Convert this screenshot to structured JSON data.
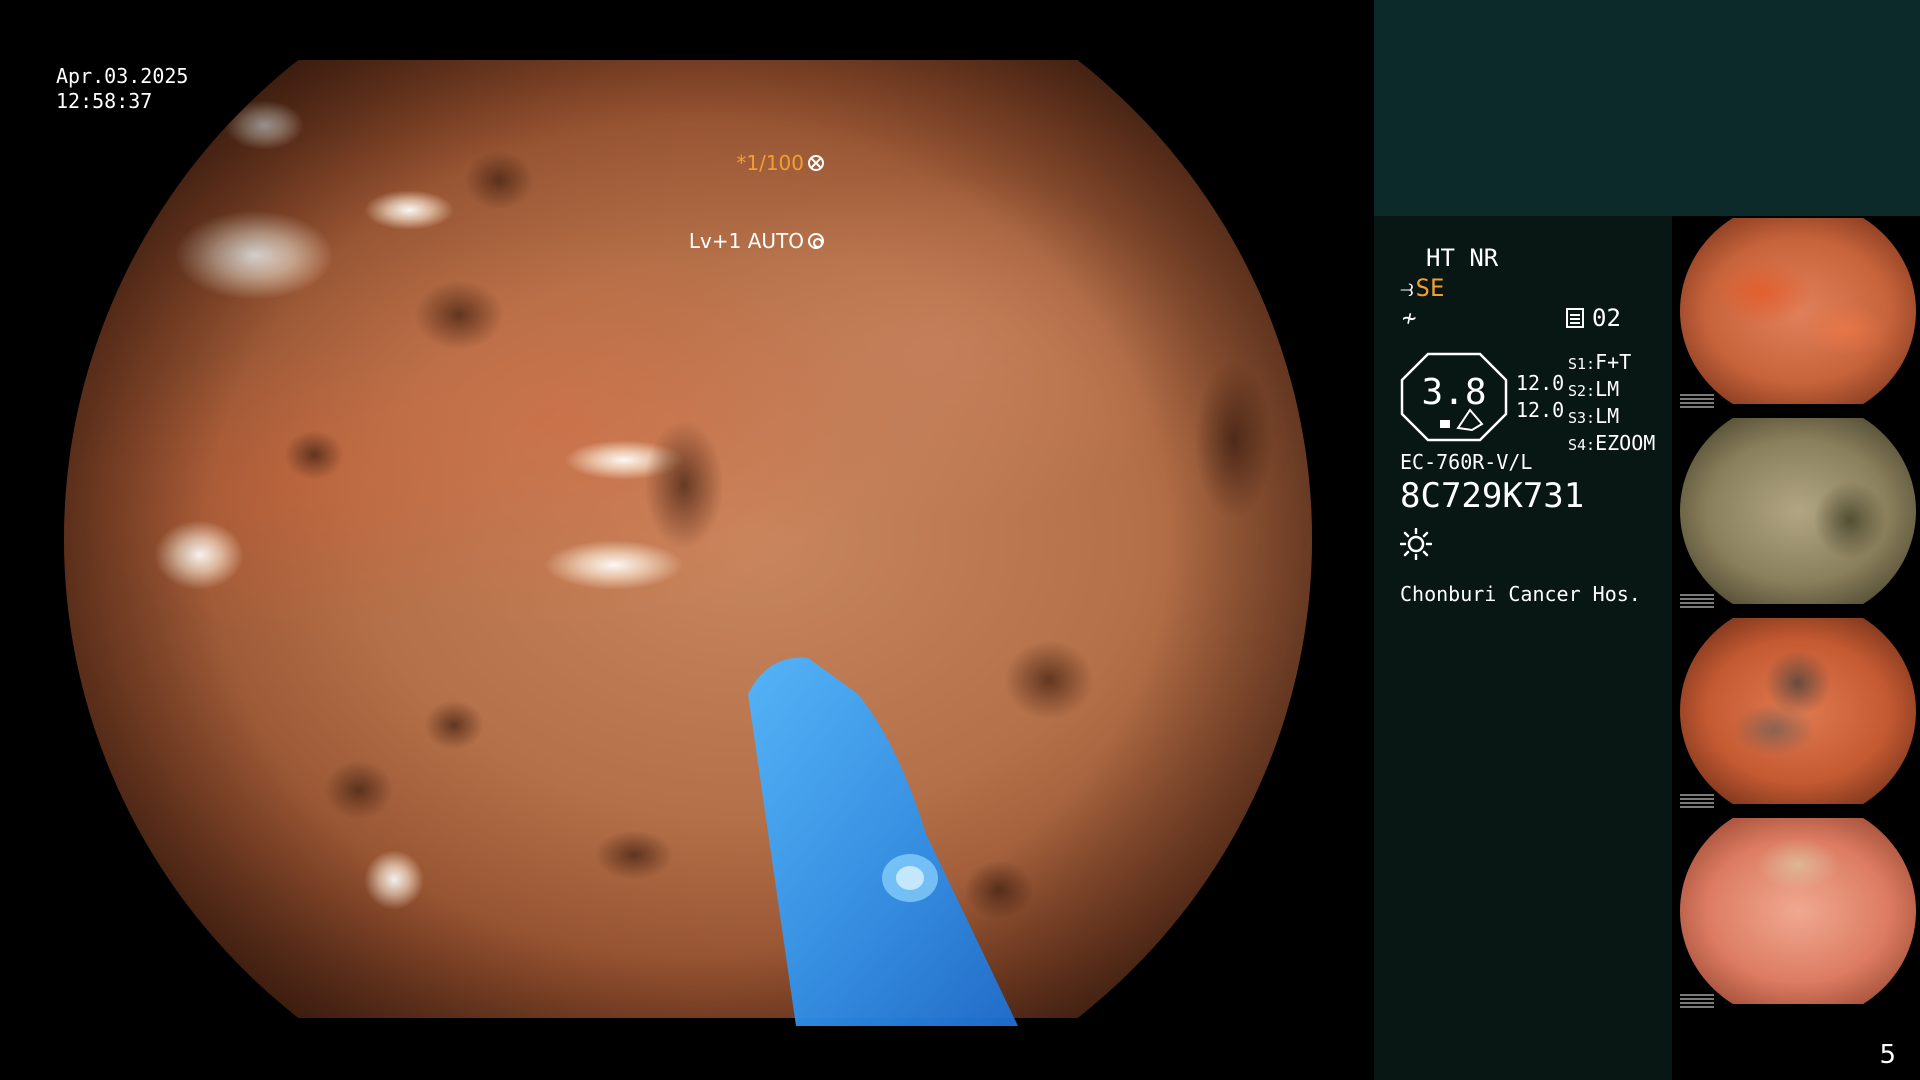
{
  "main_view": {
    "date": "Apr.03.2025",
    "time": "12:58:37",
    "shutter_label": "*1/100",
    "exposure_label": "Lv+1 AUTO"
  },
  "info_panel": {
    "mode_line": "HT NR",
    "se_label": "SE",
    "channel": "02",
    "gauge_value": "3.8",
    "gauge_side_values": [
      "12.0",
      "12.0"
    ],
    "switches": [
      {
        "key": "S1:",
        "value": "F+T"
      },
      {
        "key": "S2:",
        "value": "LM"
      },
      {
        "key": "S3:",
        "value": "LM"
      },
      {
        "key": "S4:",
        "value": "EZOOM"
      }
    ],
    "scope_model": "EC-760R-V/L",
    "scope_serial": "8C729K731",
    "hospital": "Chonburi Cancer Hos."
  },
  "thumbnails": [
    {
      "name": "thumbnail-1",
      "tone": "red"
    },
    {
      "name": "thumbnail-2",
      "tone": "olive"
    },
    {
      "name": "thumbnail-3",
      "tone": "red-debris"
    },
    {
      "name": "thumbnail-4",
      "tone": "pink"
    }
  ],
  "page_number": "5",
  "colors": {
    "accent_orange": "#f0a030",
    "panel_teal": "#0d2a2a",
    "panel_dark": "#081614"
  },
  "icons": [
    "shutter-icon",
    "auto-exposure-icon",
    "se-icon",
    "wave-icon",
    "channel-icon",
    "brightness-icon"
  ]
}
